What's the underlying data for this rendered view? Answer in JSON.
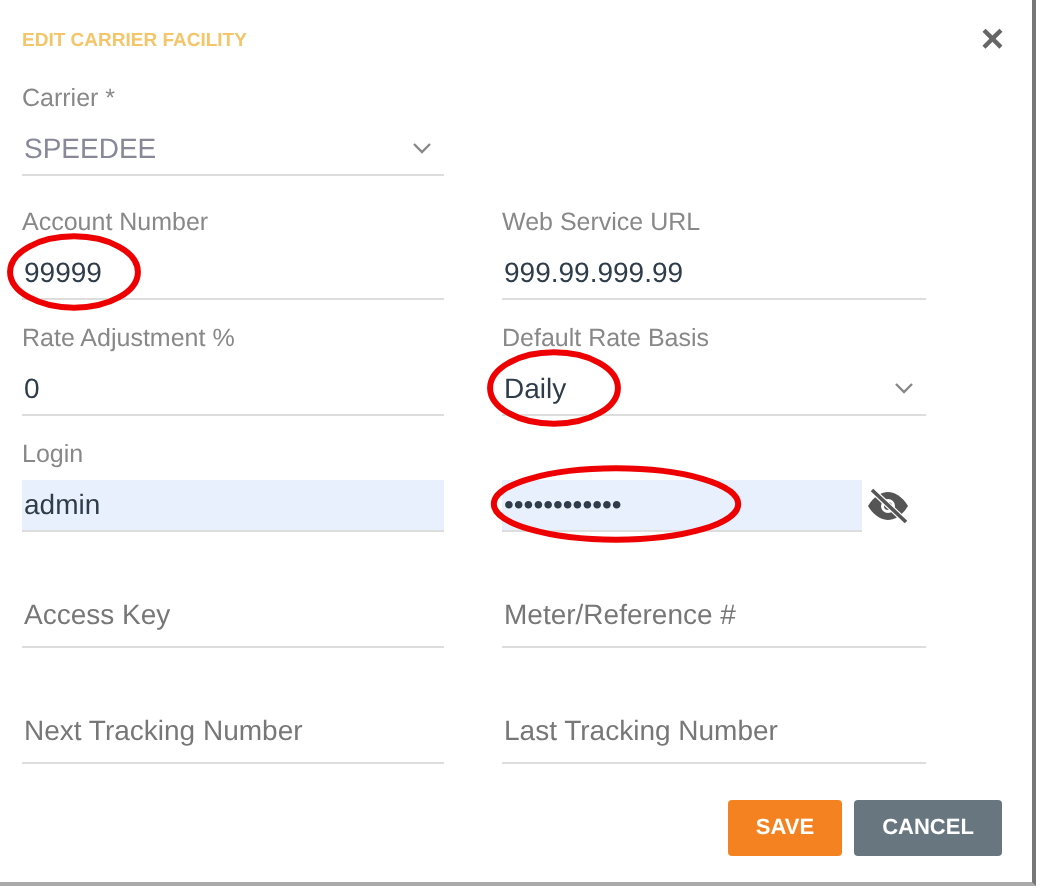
{
  "dialog": {
    "title": "EDIT CARRIER FACILITY",
    "close": "×"
  },
  "rows": [
    [
      {
        "kind": "select",
        "label": "Carrier *",
        "value": "SPEEDEE",
        "disabled": true,
        "autofilled": false
      }
    ],
    [
      {
        "kind": "text",
        "label": "Account Number",
        "value": "99999",
        "autofilled": false,
        "highlighted": true
      },
      {
        "kind": "text",
        "label": "Web Service URL",
        "value": "999.99.999.99",
        "autofilled": false
      }
    ],
    [
      {
        "kind": "text",
        "label": "Rate Adjustment %",
        "value": "0",
        "autofilled": false
      },
      {
        "kind": "select",
        "label": "Default Rate Basis",
        "value": "Daily",
        "disabled": false,
        "autofilled": false,
        "highlighted": true
      }
    ],
    [
      {
        "kind": "text",
        "label": "Login",
        "value": "admin",
        "autofilled": true
      },
      {
        "kind": "password",
        "value": "••••••••••••",
        "autofilled": true,
        "highlighted": true
      }
    ],
    [
      {
        "kind": "text",
        "placeholder": "Access Key",
        "autofilled": false
      },
      {
        "kind": "text",
        "placeholder": "Meter/Reference #",
        "autofilled": false
      }
    ],
    [
      {
        "kind": "text",
        "placeholder": "Next Tracking Number",
        "autofilled": false
      },
      {
        "kind": "text",
        "placeholder": "Last Tracking Number",
        "autofilled": false
      }
    ]
  ],
  "buttons": [
    {
      "kind": "primary",
      "label": "SAVE"
    },
    {
      "kind": "secondary",
      "label": "CANCEL"
    }
  ]
}
